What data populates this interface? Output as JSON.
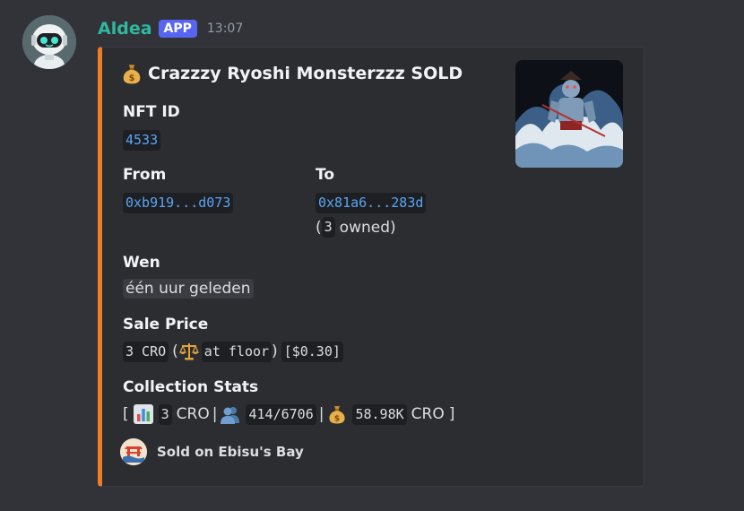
{
  "message": {
    "username": "Aldea",
    "app_tag": "APP",
    "timestamp": "13:07"
  },
  "embed": {
    "accent_color": "#ee7d28",
    "title_icon": "money-bag-icon",
    "title": "Crazzzy Ryoshi Monsterzzz SOLD",
    "fields": {
      "nft_id": {
        "name": "NFT ID",
        "value": "4533"
      },
      "from": {
        "name": "From",
        "value": "0xb919...d073"
      },
      "to": {
        "name": "To",
        "value": "0x81a6...283d",
        "owned_count": "3",
        "owned_label": "owned"
      },
      "wen": {
        "name": "Wen",
        "value": "één uur geleden"
      },
      "sale_price": {
        "name": "Sale Price",
        "amount": "3 CRO",
        "floor_icon": "balance-scale-icon",
        "floor_label": "at floor",
        "usd": "[$0.30]"
      },
      "collection_stats": {
        "name": "Collection Stats",
        "floor_icon": "bar-chart-icon",
        "floor_value": "3",
        "floor_unit": "CRO",
        "holders_icon": "people-icon",
        "holders": "414/6706",
        "volume_icon": "money-bag-icon",
        "volume": "58.98K",
        "volume_unit": "CRO"
      }
    },
    "footer": {
      "text": "Sold on Ebisu's Bay"
    }
  }
}
